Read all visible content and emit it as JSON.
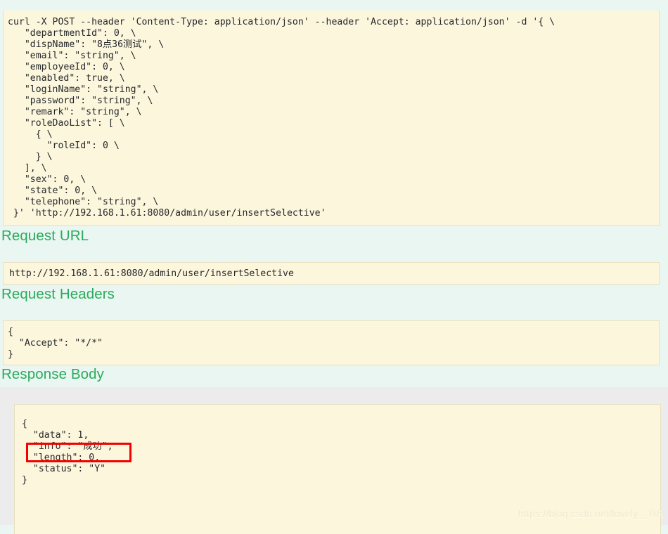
{
  "curl_block": {
    "label": "curl-command",
    "lines": [
      "curl -X POST --header 'Content-Type: application/json' --header 'Accept: application/json' -d '{ \\",
      "   \"departmentId\": 0, \\",
      "   \"dispName\": \"8点36测试\", \\",
      "   \"email\": \"string\", \\",
      "   \"employeeId\": 0, \\",
      "   \"enabled\": true, \\",
      "   \"loginName\": \"string\", \\",
      "   \"password\": \"string\", \\",
      "   \"remark\": \"string\", \\",
      "   \"roleDaoList\": [ \\",
      "     { \\",
      "       \"roleId\": 0 \\",
      "     } \\",
      "   ], \\",
      "   \"sex\": 0, \\",
      "   \"state\": 0, \\",
      "   \"telephone\": \"string\", \\",
      " }' 'http://192.168.1.61:8080/admin/user/insertSelective'"
    ]
  },
  "sections": {
    "request_url": {
      "heading": "Request URL",
      "value": "http://192.168.1.61:8080/admin/user/insertSelective"
    },
    "request_headers": {
      "heading": "Request Headers",
      "lines": [
        "{",
        "  \"Accept\": \"*/*\"",
        "}"
      ]
    },
    "response_body": {
      "heading": "Response Body",
      "lines": [
        "{",
        "  \"data\": 1,",
        "  \"info\": \"成功\",",
        "  \"length\": 0,",
        "  \"status\": \"Y\"",
        "}"
      ]
    }
  },
  "annotation": {
    "highlight_label": "info-field-highlight",
    "highlight_color": "#f40000"
  },
  "watermark": {
    "text": "https://blog.csdn.net/lovely__RR"
  },
  "colors": {
    "page_background": "#eaf6f1",
    "code_background": "#fcf6dd",
    "code_border": "#e8e0bf",
    "heading_green": "#2aab5c",
    "response_wrap_grey": "#ececec"
  }
}
